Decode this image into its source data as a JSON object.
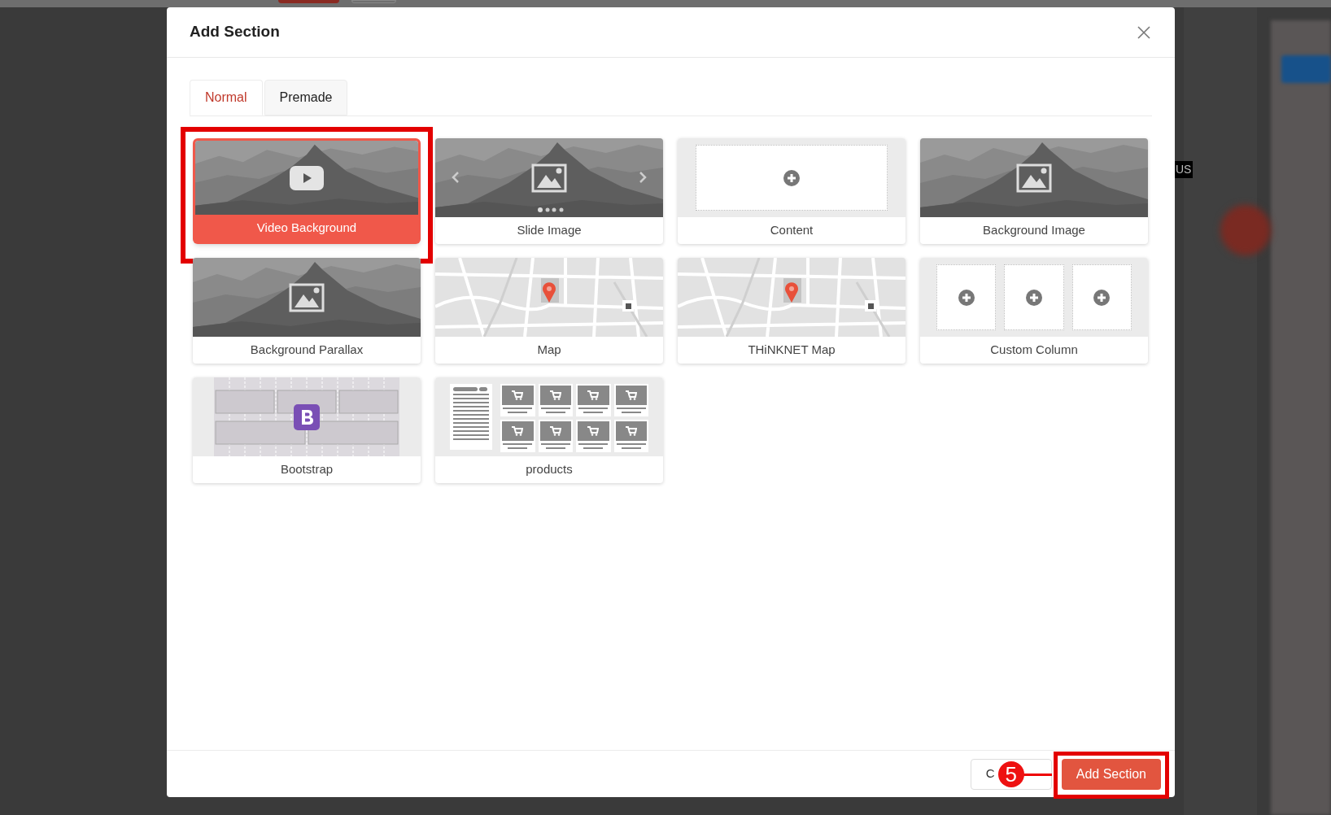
{
  "background": {
    "label": "US"
  },
  "dialog": {
    "title": "Add Section",
    "tabs": [
      {
        "label": "Normal",
        "selected": true
      },
      {
        "label": "Premade",
        "selected": false
      }
    ],
    "sections": [
      {
        "kind": "video",
        "label": "Video Background",
        "selected": true,
        "highlighted": true
      },
      {
        "kind": "slider",
        "label": "Slide Image",
        "selected": false,
        "highlighted": false
      },
      {
        "kind": "content",
        "label": "Content",
        "selected": false,
        "highlighted": false
      },
      {
        "kind": "image",
        "label": "Background Image",
        "selected": false,
        "highlighted": false
      },
      {
        "kind": "image",
        "label": "Background Parallax",
        "selected": false,
        "highlighted": false
      },
      {
        "kind": "map",
        "label": "Map",
        "selected": false,
        "highlighted": false
      },
      {
        "kind": "map",
        "label": "THiNKNET Map",
        "selected": false,
        "highlighted": false
      },
      {
        "kind": "columns",
        "label": "Custom Column",
        "selected": false,
        "highlighted": false
      },
      {
        "kind": "bootstrap",
        "label": "Bootstrap",
        "selected": false,
        "highlighted": false
      },
      {
        "kind": "products",
        "label": "products",
        "selected": false,
        "highlighted": false
      }
    ],
    "footer": {
      "cancel_label": "C",
      "confirm_label": "Add Section",
      "confirm_highlighted": true,
      "step_badge": "5"
    }
  }
}
